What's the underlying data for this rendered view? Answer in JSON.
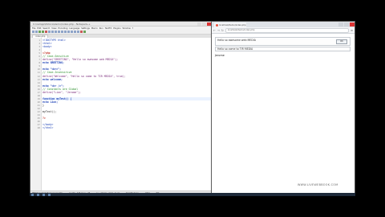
{
  "editor": {
    "title": "C:\\xampp\\htdocs\\demo\\index.php - Notepad++",
    "menu": [
      "File",
      "Edit",
      "Search",
      "View",
      "Encoding",
      "Language",
      "Settings",
      "Macro",
      "Run",
      "TextFX",
      "Plugins",
      "Window",
      "?"
    ],
    "tab": "index.php",
    "lines": [
      {
        "no": "1",
        "text": "<!DOCTYPE html>",
        "cls": "c-html"
      },
      {
        "no": "2",
        "text": "<html>",
        "cls": "c-html"
      },
      {
        "no": "3",
        "text": "<body>",
        "cls": "c-html"
      },
      {
        "no": "4",
        "text": "",
        "cls": ""
      },
      {
        "no": "5",
        "text": "<?php",
        "cls": "c-php"
      },
      {
        "no": "6",
        "text": "// Case-Sensitive",
        "cls": "c-cmt"
      },
      {
        "no": "7",
        "text": "define(\"GREETING\", \"Hello so awesome web MEDIA\");",
        "cls": "c-str"
      },
      {
        "no": "8",
        "text": "echo GREETING;",
        "cls": "c-kw"
      },
      {
        "no": "9",
        "text": "",
        "cls": ""
      },
      {
        "no": "10",
        "text": "echo \"<br>\";",
        "cls": "c-kw"
      },
      {
        "no": "11",
        "text": "// Case-Insensitive",
        "cls": "c-cmt"
      },
      {
        "no": "12",
        "text": "define(\"Welcome\", \"Hello so come to TIR MEDIA\", true);",
        "cls": "c-str"
      },
      {
        "no": "13",
        "text": "echo welcome;",
        "cls": "c-kw"
      },
      {
        "no": "14",
        "text": "",
        "cls": ""
      },
      {
        "no": "15",
        "text": "echo \"<hr />\";",
        "cls": "c-kw"
      },
      {
        "no": "16",
        "text": "// Constants are Global",
        "cls": "c-cmt"
      },
      {
        "no": "17",
        "text": "define(\"Lion\", \"Jerome\");",
        "cls": "c-str"
      },
      {
        "no": "18",
        "text": "",
        "cls": ""
      },
      {
        "no": "19",
        "text": "function myTest() {",
        "cls": "c-kw"
      },
      {
        "no": "20",
        "text": "    echo Lion;",
        "cls": "c-kw"
      },
      {
        "no": "21",
        "text": "}",
        "cls": "c-var"
      },
      {
        "no": "22",
        "text": "",
        "cls": ""
      },
      {
        "no": "23",
        "text": "myTest();",
        "cls": "c-var"
      },
      {
        "no": "24",
        "text": "",
        "cls": ""
      },
      {
        "no": "25",
        "text": "?>",
        "cls": "c-php"
      },
      {
        "no": "26",
        "text": "",
        "cls": ""
      },
      {
        "no": "27",
        "text": "</body>",
        "cls": "c-html"
      },
      {
        "no": "28",
        "text": "</html>",
        "cls": "c-html"
      }
    ],
    "current_line": 19,
    "status": {
      "type": "PHP Hypertext Preprocessor file",
      "length": "length : 436   lines : 28",
      "position": "Ln : 19   Col : 4   Sel : 0 | 0",
      "eol": "Dos\\Windows",
      "encoding": "ANSI",
      "mode": "INS"
    }
  },
  "browser": {
    "tab_title": "localhost/demo/index.php",
    "url": "localhost/demo/index.php",
    "alert_message": "Hello so awesome web MEDIA",
    "ok_label": "OK",
    "line2": "Hello so come to TIR MEDIA",
    "page_text": "Jerome"
  },
  "watermark": "WWW.LIVEWEBBOOK.COM"
}
